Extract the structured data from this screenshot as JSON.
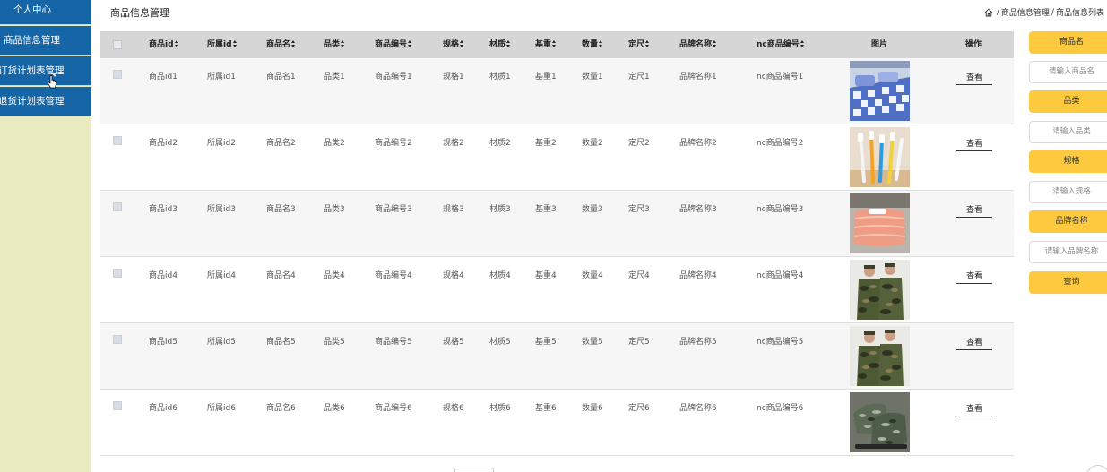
{
  "sidebar": {
    "items": [
      {
        "label": "个人中心"
      },
      {
        "label": "商品信息管理"
      },
      {
        "label": "订货计划表管理"
      },
      {
        "label": "退货计划表管理"
      }
    ]
  },
  "header": {
    "title": "商品信息管理",
    "breadcrumb": [
      "商品信息管理",
      "商品信息列表"
    ],
    "separator": "/"
  },
  "table": {
    "columns": [
      "商品id",
      "所属id",
      "商品名",
      "品类",
      "商品编号",
      "规格",
      "材质",
      "基重",
      "数量",
      "定尺",
      "品牌名称",
      "nc商品编号",
      "图片",
      "操作"
    ],
    "rows": [
      {
        "cells": [
          "商品id1",
          "所属id1",
          "商品名1",
          "品类1",
          "商品编号1",
          "规格1",
          "材质1",
          "基重1",
          "数量1",
          "定尺1",
          "品牌名称1",
          "nc商品编号1"
        ],
        "image": "bedding-photo",
        "action": "查看"
      },
      {
        "cells": [
          "商品id2",
          "所属id2",
          "商品名2",
          "品类2",
          "商品编号2",
          "规格2",
          "材质2",
          "基重2",
          "数量2",
          "定尺2",
          "品牌名称2",
          "nc商品编号2"
        ],
        "image": "toothbrush-photo",
        "action": "查看"
      },
      {
        "cells": [
          "商品id3",
          "所属id3",
          "商品名3",
          "品类3",
          "商品编号3",
          "规格3",
          "材质3",
          "基重3",
          "数量3",
          "定尺3",
          "品牌名称3",
          "nc商品编号3"
        ],
        "image": "blanket-photo",
        "action": "查看"
      },
      {
        "cells": [
          "商品id4",
          "所属id4",
          "商品名4",
          "品类4",
          "商品编号4",
          "规格4",
          "材质4",
          "基重4",
          "数量4",
          "定尺4",
          "品牌名称4",
          "nc商品编号4"
        ],
        "image": "camouflage-uniform-photo",
        "action": "查看"
      },
      {
        "cells": [
          "商品id5",
          "所属id5",
          "商品名5",
          "品类5",
          "商品编号5",
          "规格5",
          "材质5",
          "基重5",
          "数量5",
          "定尺5",
          "品牌名称5",
          "nc商品编号5"
        ],
        "image": "camouflage-uniform-photo",
        "action": "查看"
      },
      {
        "cells": [
          "商品id6",
          "所属id6",
          "商品名6",
          "品类6",
          "商品编号6",
          "规格6",
          "材质6",
          "基重6",
          "数量6",
          "定尺6",
          "品牌名称6",
          "nc商品编号6"
        ],
        "image": "camouflage-boots-photo",
        "action": "查看"
      }
    ]
  },
  "search": {
    "fields": [
      {
        "label": "商品名",
        "placeholder": "请输入商品名"
      },
      {
        "label": "品类",
        "placeholder": "请输入品类"
      },
      {
        "label": "规格",
        "placeholder": "请输入规格"
      },
      {
        "label": "品牌名称",
        "placeholder": "请输入品牌名称"
      }
    ],
    "button": "查询"
  },
  "colors": {
    "sidebar_bg": "#eaebc1",
    "nav_bg": "#1565a7",
    "accent": "#fcc93f",
    "header_row": "#d6d6d6"
  },
  "icons": {
    "home": "home-icon",
    "sort": "sort-icon",
    "cursor": "hand-cursor-icon"
  }
}
